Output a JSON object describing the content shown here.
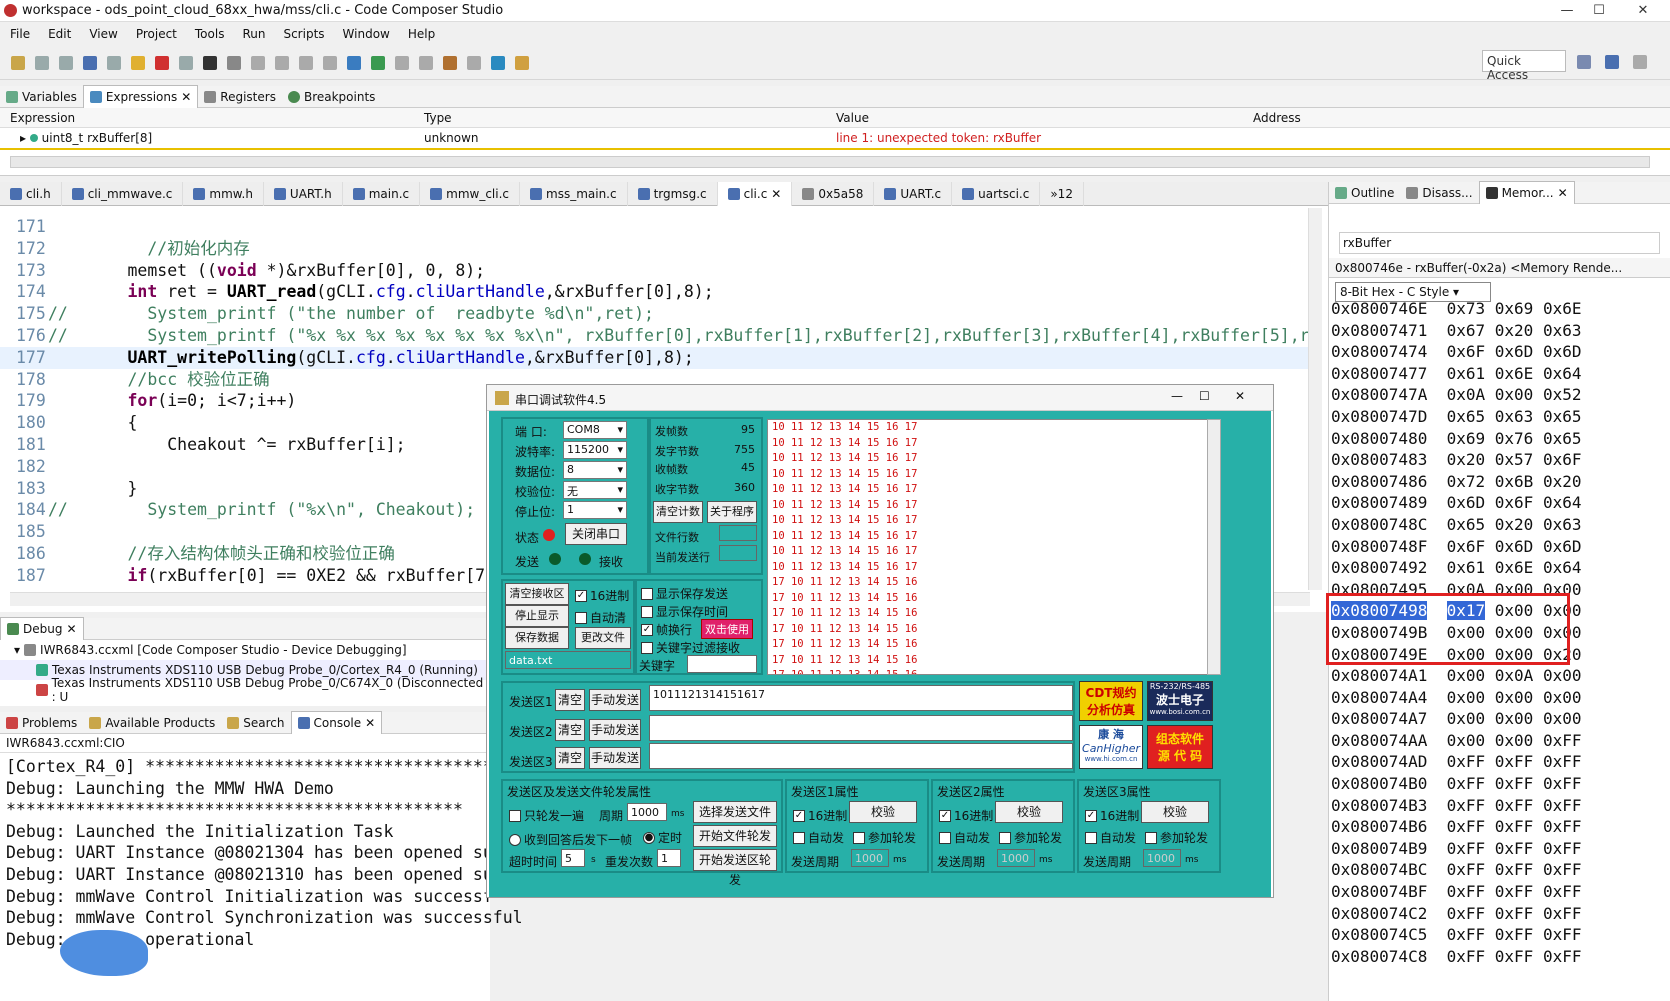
{
  "window": {
    "title": "workspace - ods_point_cloud_68xx_hwa/mss/cli.c - Code Composer Studio"
  },
  "menu": [
    "File",
    "Edit",
    "View",
    "Project",
    "Tools",
    "Run",
    "Scripts",
    "Window",
    "Help"
  ],
  "toolbar": {
    "quick_access": "Quick Access"
  },
  "expressions": {
    "tabs": [
      {
        "label": "Variables"
      },
      {
        "label": "Expressions"
      },
      {
        "label": "Registers"
      },
      {
        "label": "Breakpoints"
      }
    ],
    "columns": [
      "Expression",
      "Type",
      "Value",
      "Address"
    ],
    "row": {
      "expression": "uint8_t rxBuffer[8]",
      "type": "unknown",
      "value": "line 1: unexpected token: rxBuffer",
      "address": ""
    }
  },
  "editor": {
    "tabs": [
      "cli.h",
      "cli_mmwave.c",
      "mmw.h",
      "UART.h",
      "main.c",
      "mmw_cli.c",
      "mss_main.c",
      "trgmsg.c",
      "cli.c",
      "0x5a58",
      "UART.c",
      "uartsci.c",
      "»12"
    ],
    "active_tab": "cli.c"
  },
  "memory": {
    "tabs": [
      "Outline",
      "Disass...",
      "Memor..."
    ],
    "search": "rxBuffer",
    "title": "0x800746e - rxBuffer(-0x2a) <Memory Rende...",
    "format": "8-Bit Hex - C Style",
    "rows": [
      {
        "addr": "0x0800746E",
        "b": [
          "0x73",
          "0x69",
          "0x6E"
        ]
      },
      {
        "addr": "0x08007471",
        "b": [
          "0x67",
          "0x20",
          "0x63"
        ]
      },
      {
        "addr": "0x08007474",
        "b": [
          "0x6F",
          "0x6D",
          "0x6D"
        ]
      },
      {
        "addr": "0x08007477",
        "b": [
          "0x61",
          "0x6E",
          "0x64"
        ]
      },
      {
        "addr": "0x0800747A",
        "b": [
          "0x0A",
          "0x00",
          "0x52"
        ]
      },
      {
        "addr": "0x0800747D",
        "b": [
          "0x65",
          "0x63",
          "0x65"
        ]
      },
      {
        "addr": "0x08007480",
        "b": [
          "0x69",
          "0x76",
          "0x65"
        ]
      },
      {
        "addr": "0x08007483",
        "b": [
          "0x20",
          "0x57",
          "0x6F"
        ]
      },
      {
        "addr": "0x08007486",
        "b": [
          "0x72",
          "0x6B",
          "0x20"
        ]
      },
      {
        "addr": "0x08007489",
        "b": [
          "0x6D",
          "0x6F",
          "0x64"
        ]
      },
      {
        "addr": "0x0800748C",
        "b": [
          "0x65",
          "0x20",
          "0x63"
        ]
      },
      {
        "addr": "0x0800748F",
        "b": [
          "0x6F",
          "0x6D",
          "0x6D"
        ]
      },
      {
        "addr": "0x08007492",
        "b": [
          "0x61",
          "0x6E",
          "0x64"
        ]
      },
      {
        "addr": "0x08007495",
        "b": [
          "0x0A",
          "0x00",
          "0x00"
        ]
      },
      {
        "addr": "0x08007498",
        "b": [
          "0x17",
          "0x00",
          "0x00"
        ]
      },
      {
        "addr": "0x0800749B",
        "b": [
          "0x00",
          "0x00",
          "0x00"
        ]
      },
      {
        "addr": "0x0800749E",
        "b": [
          "0x00",
          "0x00",
          "0x20"
        ]
      },
      {
        "addr": "0x080074A1",
        "b": [
          "0x00",
          "0x0A",
          "0x00"
        ]
      },
      {
        "addr": "0x080074A4",
        "b": [
          "0x00",
          "0x00",
          "0x00"
        ]
      },
      {
        "addr": "0x080074A7",
        "b": [
          "0x00",
          "0x00",
          "0x00"
        ]
      },
      {
        "addr": "0x080074AA",
        "b": [
          "0x00",
          "0x00",
          "0xFF"
        ]
      },
      {
        "addr": "0x080074AD",
        "b": [
          "0xFF",
          "0xFF",
          "0xFF"
        ]
      },
      {
        "addr": "0x080074B0",
        "b": [
          "0xFF",
          "0xFF",
          "0xFF"
        ]
      },
      {
        "addr": "0x080074B3",
        "b": [
          "0xFF",
          "0xFF",
          "0xFF"
        ]
      },
      {
        "addr": "0x080074B6",
        "b": [
          "0xFF",
          "0xFF",
          "0xFF"
        ]
      },
      {
        "addr": "0x080074B9",
        "b": [
          "0xFF",
          "0xFF",
          "0xFF"
        ]
      },
      {
        "addr": "0x080074BC",
        "b": [
          "0xFF",
          "0xFF",
          "0xFF"
        ]
      },
      {
        "addr": "0x080074BF",
        "b": [
          "0xFF",
          "0xFF",
          "0xFF"
        ]
      },
      {
        "addr": "0x080074C2",
        "b": [
          "0xFF",
          "0xFF",
          "0xFF"
        ]
      },
      {
        "addr": "0x080074C5",
        "b": [
          "0xFF",
          "0xFF",
          "0xFF"
        ]
      },
      {
        "addr": "0x080074C8",
        "b": [
          "0xFF",
          "0xFF",
          "0xFF"
        ]
      }
    ]
  },
  "debug": {
    "tab": "Debug",
    "items": [
      "IWR6843.ccxml [Code Composer Studio - Device Debugging]",
      "Texas Instruments XDS110 USB Debug Probe_0/Cortex_R4_0 (Running)",
      "Texas Instruments XDS110 USB Debug Probe_0/C674X_0 (Disconnected : U"
    ]
  },
  "console": {
    "tabs": [
      "Problems",
      "Available Products",
      "Search",
      "Console"
    ],
    "subtitle": "IWR6843.ccxml:CIO",
    "lines": [
      "[Cortex_R4_0] ****************************************",
      "Debug: Launching the MMW HWA Demo",
      "**********************************************",
      "Debug: Launched the Initialization Task",
      "Debug: UART Instance @08021304 has been opened su",
      "Debug: UART Instance @08021310 has been opened su",
      "Debug: mmWave Control Initialization was successf",
      "Debug: mmWave Control Synchronization was successful",
      "Debug:        operational"
    ]
  },
  "serial": {
    "title": "串口调试软件4.5",
    "port_label": "端  口:",
    "port": "COM8",
    "baud_label": "波特率:",
    "baud": "115200",
    "data_label": "数据位:",
    "data": "8",
    "parity_label": "校验位:",
    "parity": "无",
    "stop_label": "停止位:",
    "stop": "1",
    "state_label": "状态",
    "close_btn": "关闭串口",
    "send_label": "发送",
    "recv_label": "接收",
    "stats": [
      {
        "k": "发帧数",
        "v": "95"
      },
      {
        "k": "发字节数",
        "v": "755"
      },
      {
        "k": "收帧数",
        "v": "45"
      },
      {
        "k": "收字节数",
        "v": "360"
      }
    ],
    "clear_count": "清空计数",
    "about": "关于程序",
    "file_lines": "文件行数",
    "cur_line": "当前发送行",
    "clear_recv": "清空接收区",
    "hex16": "16进制",
    "stop_show": "停止显示",
    "auto_clear": "自动清",
    "save_data": "保存数据",
    "change_file": "更改文件",
    "filename": "data.txt",
    "show_send": "显示保存发送",
    "show_time": "显示保存时间",
    "frame_wrap": "帧换行",
    "use_tip": "双击使用",
    "kw_filter": "关键字过滤接收",
    "kw_label": "关键字",
    "rx_lines": [
      "10 11 12 13 14 15 16 17",
      "10 11 12 13 14 15 16 17",
      "10 11 12 13 14 15 16 17",
      "10 11 12 13 14 15 16 17",
      "10 11 12 13 14 15 16 17",
      "10 11 12 13 14 15 16 17",
      "10 11 12 13 14 15 16 17",
      "10 11 12 13 14 15 16 17",
      "10 11 12 13 14 15 16 17",
      "10 11 12 13 14 15 16 17",
      "17 10 11 12 13 14 15 16",
      "17 10 11 12 13 14 15 16",
      "17 10 11 12 13 14 15 16",
      "17 10 11 12 13 14 15 16",
      "17 10 11 12 13 14 15 16",
      "17 10 11 12 13 14 15 16",
      "17 10 11 12 13 14 15 16",
      "10 11 12 13 14 15 16 17"
    ],
    "send1_label": "发送区1",
    "send2_label": "发送区2",
    "send3_label": "发送区3",
    "clear": "清空",
    "manual": "手动发送",
    "send1_value": "1011121314151617",
    "brand1": "CDT规约 分析仿真",
    "brand2": "波士电子",
    "brand2_sub": "www.bosi.com.cn",
    "brand2_top": "RS-232/RS-485",
    "brand3": "康 海",
    "brand3_sub": "CanHigher",
    "brand3_url": "www.hi.com.cn",
    "brand4": "组态软件 源 代 码",
    "poll_group": "发送区及发送文件轮发属性",
    "send_once": "只轮发一遍",
    "period": "周期",
    "period_val": "1000",
    "ms": "ms",
    "select_file": "选择发送文件",
    "start_file": "开始文件轮发",
    "recv_next": "收到回答后发下一帧",
    "timed": "定时",
    "timeout": "超时时间",
    "timeout_val": "5",
    "s": "s",
    "retries": "重发次数",
    "retries_val": "1",
    "start_area": "开始发送区轮发",
    "g1": "发送区1属性",
    "g2": "发送区2属性",
    "g3": "发送区3属性",
    "verify": "校验",
    "auto_send": "自动发",
    "join_poll": "参加轮发",
    "send_period": "发送周期",
    "gp_val": "1000"
  }
}
